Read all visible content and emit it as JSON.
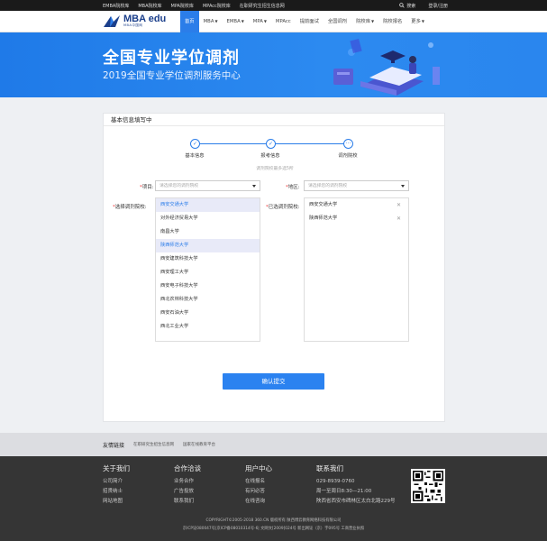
{
  "topbar": {
    "links": [
      "EMBA院校库",
      "MBA院校库",
      "MPA院校库",
      "MPAcc院校库",
      "在职研究生招生信息网"
    ],
    "search": "搜索",
    "login": "登录/注册"
  },
  "logo": {
    "name": "MBA edu",
    "sub": "MBA中国网"
  },
  "nav": {
    "items": [
      {
        "label": "首页",
        "active": true,
        "caret": false
      },
      {
        "label": "MBA",
        "caret": true
      },
      {
        "label": "EMBA",
        "caret": true
      },
      {
        "label": "MPA",
        "caret": true
      },
      {
        "label": "MPAcc",
        "caret": false
      },
      {
        "label": "提前面试",
        "caret": false
      },
      {
        "label": "全国调剂",
        "caret": false
      },
      {
        "label": "院校库",
        "caret": true
      },
      {
        "label": "院校报名",
        "caret": false
      },
      {
        "label": "更多",
        "caret": true
      }
    ]
  },
  "banner": {
    "title": "全国专业学位调剂",
    "subtitle": "2019全国专业学位调剂服务中心"
  },
  "form": {
    "title": "基本信息填写中",
    "steps": [
      "基本信息",
      "报考信息",
      "调剂院校"
    ],
    "hint": "调剂院校最多选5所",
    "project_label": "项目",
    "project_placeholder": "请选择您的调剂院校",
    "region_label": "地区",
    "region_placeholder": "请选择您的调剂院校",
    "choose_label": "选择调剂院校",
    "chosen_label": "已选调剂院校",
    "schools": [
      "西安交通大学",
      "对外经济贸易大学",
      "南昌大学",
      "陕西师范大学",
      "西安建筑科技大学",
      "西安理工大学",
      "西安电子科技大学",
      "西北农林科技大学",
      "西安石油大学",
      "西北工业大学"
    ],
    "selected_indices": [
      0,
      3
    ],
    "chosen": [
      "西安交通大学",
      "陕西师范大学"
    ],
    "submit": "确认提交"
  },
  "friend_links": {
    "heading": "友情链接",
    "links": [
      "在职研究生招生信息网",
      "国家在线教育平台"
    ]
  },
  "footer": {
    "cols": [
      {
        "title": "关于我们",
        "items": [
          "公司简介",
          "招贤纳士",
          "网站地图"
        ]
      },
      {
        "title": "合作洽谈",
        "items": [
          "业务合作",
          "广告投放",
          "联系我们"
        ]
      },
      {
        "title": "用户中心",
        "items": [
          "在线报名",
          "有问必答",
          "在线咨询"
        ]
      },
      {
        "title": "联系我们",
        "items": [
          "029-8939-0760",
          "周一至周日8:30—21:00",
          "陕西省西安市碑林区太白北路229号"
        ]
      }
    ],
    "copyright1": "COPYRIGHT©2005-2018 360.CN 版权所有 陕西博云教育网络科技有限公司",
    "copyright2": "京ICP证080047号|京ICP备08010314号-6| 文网文[2009]024号 新出网证（京）字095号 工商营业执照"
  }
}
